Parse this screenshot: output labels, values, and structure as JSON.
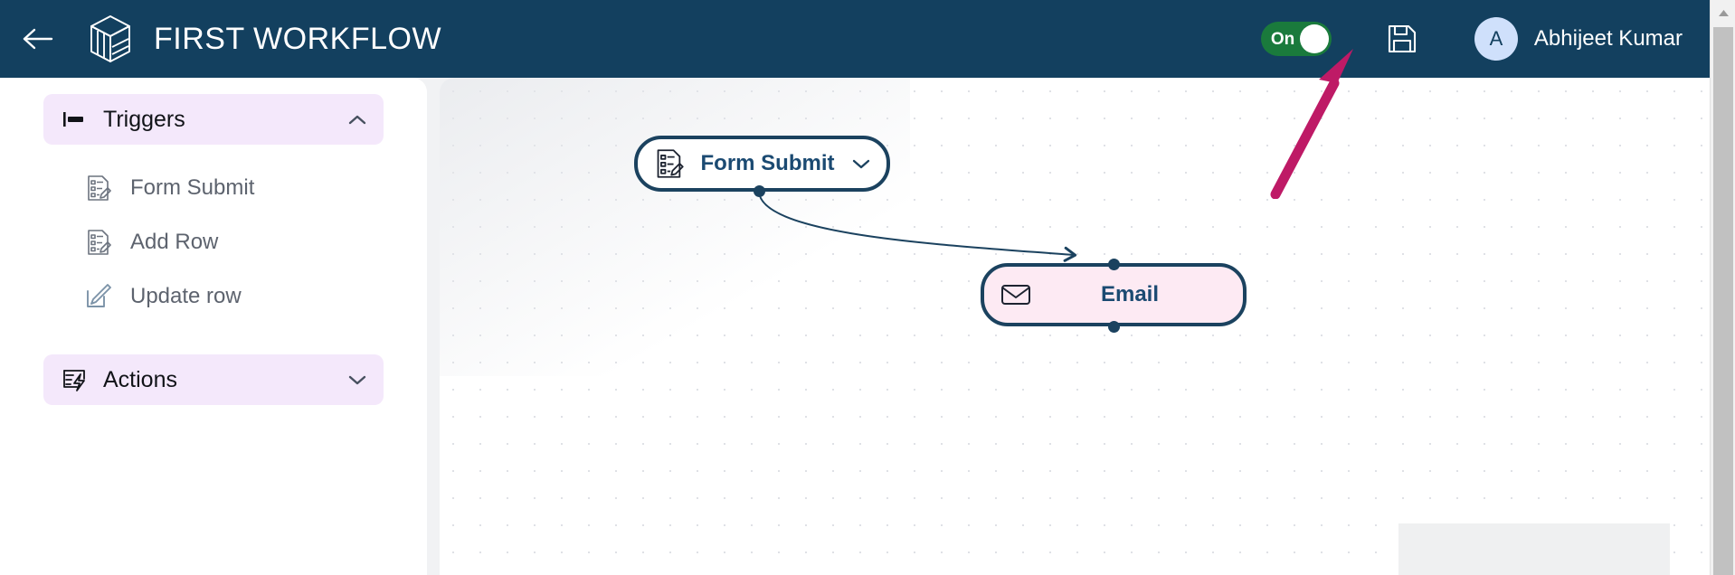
{
  "header": {
    "back_icon": "arrow-left-icon",
    "logo_icon": "cube-logo-icon",
    "title": "FIRST WORKFLOW",
    "toggle": {
      "label": "On",
      "state": "on",
      "color": "#1a7a3c"
    },
    "save_icon": "floppy-disk-save-icon",
    "user": {
      "initial": "A",
      "name": "Abhijeet Kumar",
      "avatar_color": "#cfe0fb"
    },
    "background_color": "#13405f"
  },
  "sidebar": {
    "sections": [
      {
        "label": "Triggers",
        "icon": "trigger-flag-icon",
        "expanded": true,
        "chevron": "chevron-up-icon",
        "header_color": "#f4e8fb",
        "items": [
          {
            "label": "Form Submit",
            "icon": "form-document-icon"
          },
          {
            "label": "Add Row",
            "icon": "form-document-icon"
          },
          {
            "label": "Update row",
            "icon": "edit-pencil-square-icon"
          }
        ]
      },
      {
        "label": "Actions",
        "icon": "actions-lightning-icon",
        "expanded": false,
        "chevron": "chevron-down-icon",
        "header_color": "#f4e8fb",
        "items": []
      }
    ]
  },
  "canvas": {
    "nodes": [
      {
        "id": "form-submit",
        "label": "Form Submit",
        "icon": "form-document-icon",
        "chevron": "chevron-down-icon",
        "type": "trigger",
        "background": "#ffffff",
        "border_color": "#1b425f"
      },
      {
        "id": "email",
        "label": "Email",
        "icon": "envelope-icon",
        "type": "action",
        "background": "#fdeaf3",
        "border_color": "#1b425f"
      }
    ],
    "edges": [
      {
        "from": "form-submit",
        "to": "email"
      }
    ]
  },
  "annotation": {
    "type": "arrow",
    "color": "#be1a66",
    "points_to": "save-button"
  },
  "scrollbar": {
    "up_arrow": "triangle-up-icon",
    "orientation": "vertical"
  }
}
